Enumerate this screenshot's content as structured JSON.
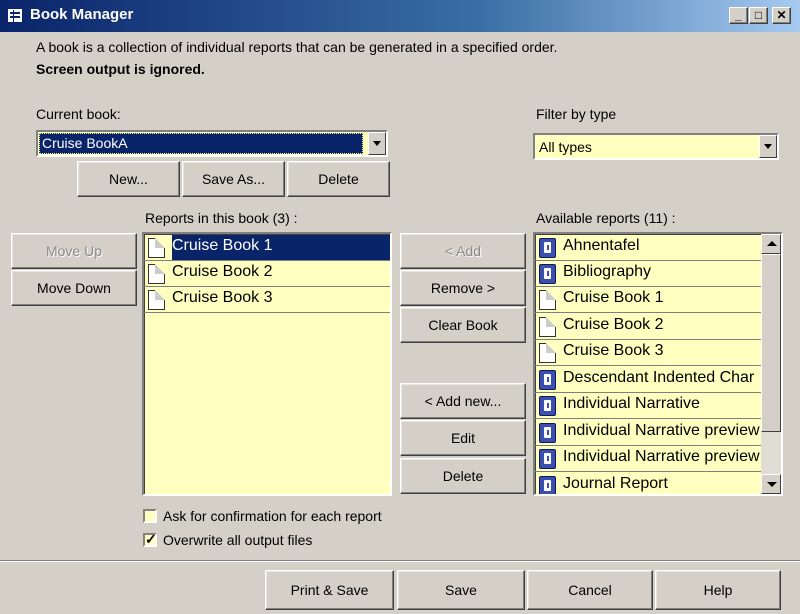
{
  "window": {
    "title": "Book Manager"
  },
  "description": {
    "line1": "A book is a collection of individual reports that can be generated in a specified order.",
    "line2": "Screen output is ignored."
  },
  "current_book": {
    "label": "Current book:",
    "value": "Cruise BookA"
  },
  "filter": {
    "label": "Filter by type",
    "value": "All types"
  },
  "book_buttons": {
    "new": "New...",
    "save_as": "Save As...",
    "delete": "Delete"
  },
  "reports_in_book": {
    "label": "Reports in this book (3) :",
    "items": [
      {
        "label": "Cruise Book 1",
        "icon": "page-icon",
        "selected": true
      },
      {
        "label": "Cruise Book 2",
        "icon": "page-icon",
        "selected": false
      },
      {
        "label": "Cruise Book 3",
        "icon": "page-icon",
        "selected": false
      }
    ]
  },
  "move_buttons": {
    "up": "Move Up",
    "down": "Move Down"
  },
  "middle_buttons": {
    "add": "< Add",
    "remove": "Remove >",
    "clear": "Clear Book",
    "add_new": "< Add new...",
    "edit": "Edit",
    "delete": "Delete"
  },
  "available_reports": {
    "label": "Available reports (11) :",
    "items": [
      {
        "label": "Ahnentafel",
        "icon": "book-icon"
      },
      {
        "label": "Bibliography",
        "icon": "book-icon"
      },
      {
        "label": "Cruise Book 1",
        "icon": "page-icon"
      },
      {
        "label": "Cruise Book 2",
        "icon": "page-icon"
      },
      {
        "label": "Cruise Book 3",
        "icon": "page-icon"
      },
      {
        "label": "Descendant Indented Char",
        "icon": "book-icon"
      },
      {
        "label": "Individual Narrative",
        "icon": "book-icon"
      },
      {
        "label": "Individual Narrative preview",
        "icon": "book-icon"
      },
      {
        "label": "Individual Narrative preview",
        "icon": "book-icon"
      },
      {
        "label": "Journal Report",
        "icon": "book-icon"
      }
    ]
  },
  "options": {
    "ask_confirmation": {
      "label": "Ask for confirmation for each report",
      "checked": false
    },
    "overwrite": {
      "label": "Overwrite all output files",
      "checked": true
    }
  },
  "footer": {
    "print_save": "Print & Save",
    "save": "Save",
    "cancel": "Cancel",
    "help": "Help"
  },
  "colors": {
    "title_bar": "#0a246a",
    "list_bg": "#ffffc0",
    "selection": "#0a246a",
    "dialog_bg": "#d4d0c8"
  }
}
